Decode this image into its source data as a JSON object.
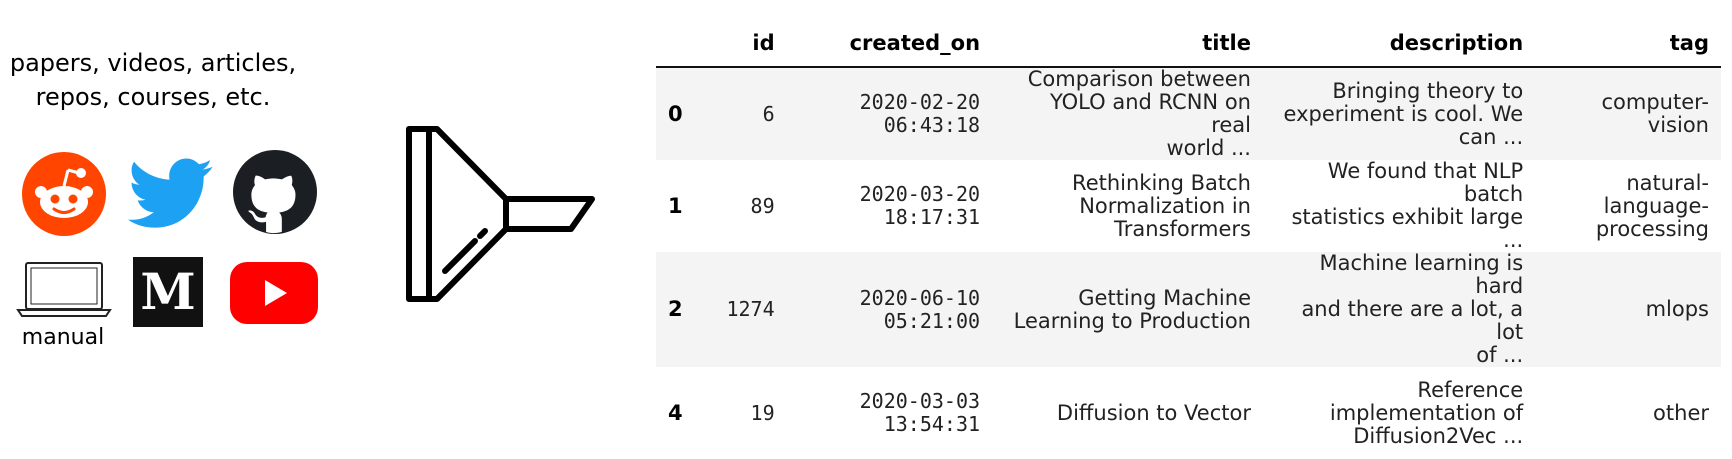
{
  "sources": {
    "caption_line1": "papers, videos, articles,",
    "caption_line2": "repos, courses, etc.",
    "icons": [
      "reddit-icon",
      "twitter-icon",
      "github-icon",
      "laptop-icon",
      "medium-icon",
      "youtube-icon"
    ],
    "medium_letter": "M",
    "manual_label": "manual",
    "colors": {
      "reddit": "#ff4500",
      "twitter": "#1da1f2",
      "github": "#1b1f23",
      "medium": "#111111",
      "youtube": "#ff0000"
    }
  },
  "funnel": {
    "icon": "funnel-icon"
  },
  "table": {
    "columns": {
      "index": "",
      "id": "id",
      "created_on": "created_on",
      "title": "title",
      "description": "description",
      "tag": "tag"
    },
    "rows": [
      {
        "index": "0",
        "id": "6",
        "created_on": "2020-02-20\n06:43:18",
        "title": "Comparison between\nYOLO and RCNN on real\nworld ...",
        "description": "Bringing theory to\nexperiment is cool. We\ncan ...",
        "tag": "computer-\nvision"
      },
      {
        "index": "1",
        "id": "89",
        "created_on": "2020-03-20\n18:17:31",
        "title": "Rethinking Batch\nNormalization in\nTransformers",
        "description": "We found that NLP batch\nstatistics exhibit large ...",
        "tag": "natural-\nlanguage-\nprocessing"
      },
      {
        "index": "2",
        "id": "1274",
        "created_on": "2020-06-10\n05:21:00",
        "title": "Getting Machine\nLearning to Production",
        "description": "Machine learning is hard\nand there are a lot, a lot\nof ...",
        "tag": "mlops"
      },
      {
        "index": "4",
        "id": "19",
        "created_on": "2020-03-03\n13:54:31",
        "title": "Diffusion to Vector",
        "description": "Reference\nimplementation of\nDiffusion2Vec ...",
        "tag": "other"
      }
    ]
  }
}
